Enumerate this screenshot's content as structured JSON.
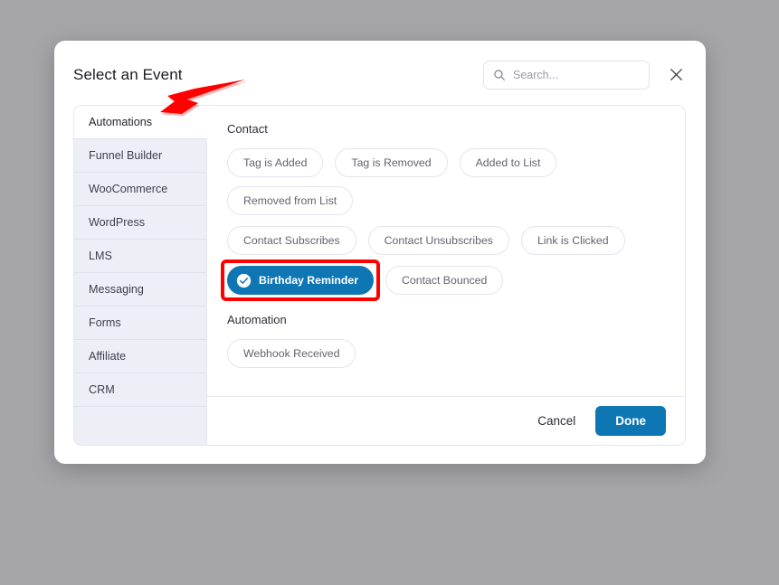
{
  "dialog": {
    "title": "Select an Event",
    "close_label": "×",
    "close_icon": "close-icon"
  },
  "search": {
    "placeholder": "Search...",
    "value": "",
    "icon": "search-icon"
  },
  "sidebar": {
    "items": [
      {
        "label": "Automations",
        "active": true
      },
      {
        "label": "Funnel Builder",
        "active": false
      },
      {
        "label": "WooCommerce",
        "active": false
      },
      {
        "label": "WordPress",
        "active": false
      },
      {
        "label": "LMS",
        "active": false
      },
      {
        "label": "Messaging",
        "active": false
      },
      {
        "label": "Forms",
        "active": false
      },
      {
        "label": "Affiliate",
        "active": false
      },
      {
        "label": "CRM",
        "active": false
      }
    ]
  },
  "content": {
    "groups": [
      {
        "title": "Contact",
        "rows": [
          [
            {
              "label": "Tag is Added",
              "selected": false,
              "highlighted": false
            },
            {
              "label": "Tag is Removed",
              "selected": false,
              "highlighted": false
            },
            {
              "label": "Added to List",
              "selected": false,
              "highlighted": false
            },
            {
              "label": "Removed from List",
              "selected": false,
              "highlighted": false
            }
          ],
          [
            {
              "label": "Contact Subscribes",
              "selected": false,
              "highlighted": false
            },
            {
              "label": "Contact Unsubscribes",
              "selected": false,
              "highlighted": false
            },
            {
              "label": "Link is Clicked",
              "selected": false,
              "highlighted": false
            }
          ],
          [
            {
              "label": "Birthday Reminder",
              "selected": true,
              "highlighted": true,
              "icon": "check-circle-icon"
            },
            {
              "label": "Contact Bounced",
              "selected": false,
              "highlighted": false
            }
          ]
        ]
      },
      {
        "title": "Automation",
        "rows": [
          [
            {
              "label": "Webhook Received",
              "selected": false,
              "highlighted": false
            }
          ]
        ]
      }
    ]
  },
  "footer": {
    "cancel_label": "Cancel",
    "done_label": "Done"
  },
  "annotations": {
    "arrow": {
      "name": "red-arrow-pointer",
      "color": "#ff0000",
      "points_to": "Automations"
    },
    "highlight_box_color": "#ff0000"
  },
  "colors": {
    "accent": "#0f76b4",
    "overlay": "#a6a6a8",
    "sidebar_bg": "#eeeef7",
    "border": "#e6e6ee"
  }
}
